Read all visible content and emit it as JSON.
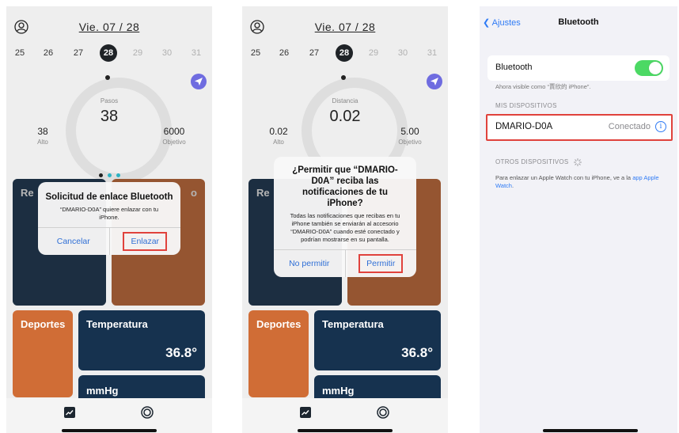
{
  "screens": {
    "app": {
      "date": "Vie. 07 / 28",
      "days": [
        "25",
        "26",
        "27",
        "28",
        "29",
        "30",
        "31"
      ],
      "selected_day": "28"
    },
    "pairing": {
      "ring_label": "Pasos",
      "ring_value": "38",
      "left_value": "38",
      "left_label": "Alto",
      "right_value": "6000",
      "right_label": "Objetivo",
      "dialog": {
        "title": "Solicitud de enlace Bluetooth",
        "message": "“DMARIO-D0A” quiere enlazar con tu iPhone.",
        "cancel": "Cancelar",
        "confirm": "Enlazar"
      }
    },
    "notifications": {
      "ring_label": "Distancia",
      "ring_value": "0.02",
      "left_value": "0.02",
      "left_label": "Alto",
      "right_value": "5.00",
      "right_label": "Objetivo",
      "dialog": {
        "title": "¿Permitir que “DMARIO-D0A” reciba las notificaciones de tu iPhone?",
        "message": "Todas las notificaciones que recibas en tu iPhone también se enviarán al accesorio “DMARIO-D0A” cuando esté conectado y podrían mostrarse en su pantalla.",
        "deny": "No permitir",
        "allow": "Permitir"
      }
    },
    "tiles": {
      "tile_top_left_fragment": "Re",
      "tile_top_right_fragment": "o",
      "sports": "Deportes",
      "temperature_label": "Temperatura",
      "temperature_value": "36.8°",
      "pressure_label": "mmHg"
    },
    "settings": {
      "back": "Ajustes",
      "title": "Bluetooth",
      "bluetooth_label": "Bluetooth",
      "visible_as": "Ahora visible como “賈欣的 iPhone”.",
      "my_devices": "MIS DISPOSITIVOS",
      "device_name": "DMARIO-D0A",
      "device_status": "Conectado",
      "other_devices": "OTROS DISPOSITIVOS",
      "help_text": "Para enlazar un Apple Watch con tu iPhone, ve a la",
      "help_link": "app Apple Watch",
      "help_end": "."
    }
  },
  "colors": {
    "accent_blue": "#2f7bf5",
    "highlight_red": "#e0423c",
    "navy_tile": "#16324f",
    "orange_tile": "#d06d36",
    "toggle_green": "#4cd964"
  }
}
